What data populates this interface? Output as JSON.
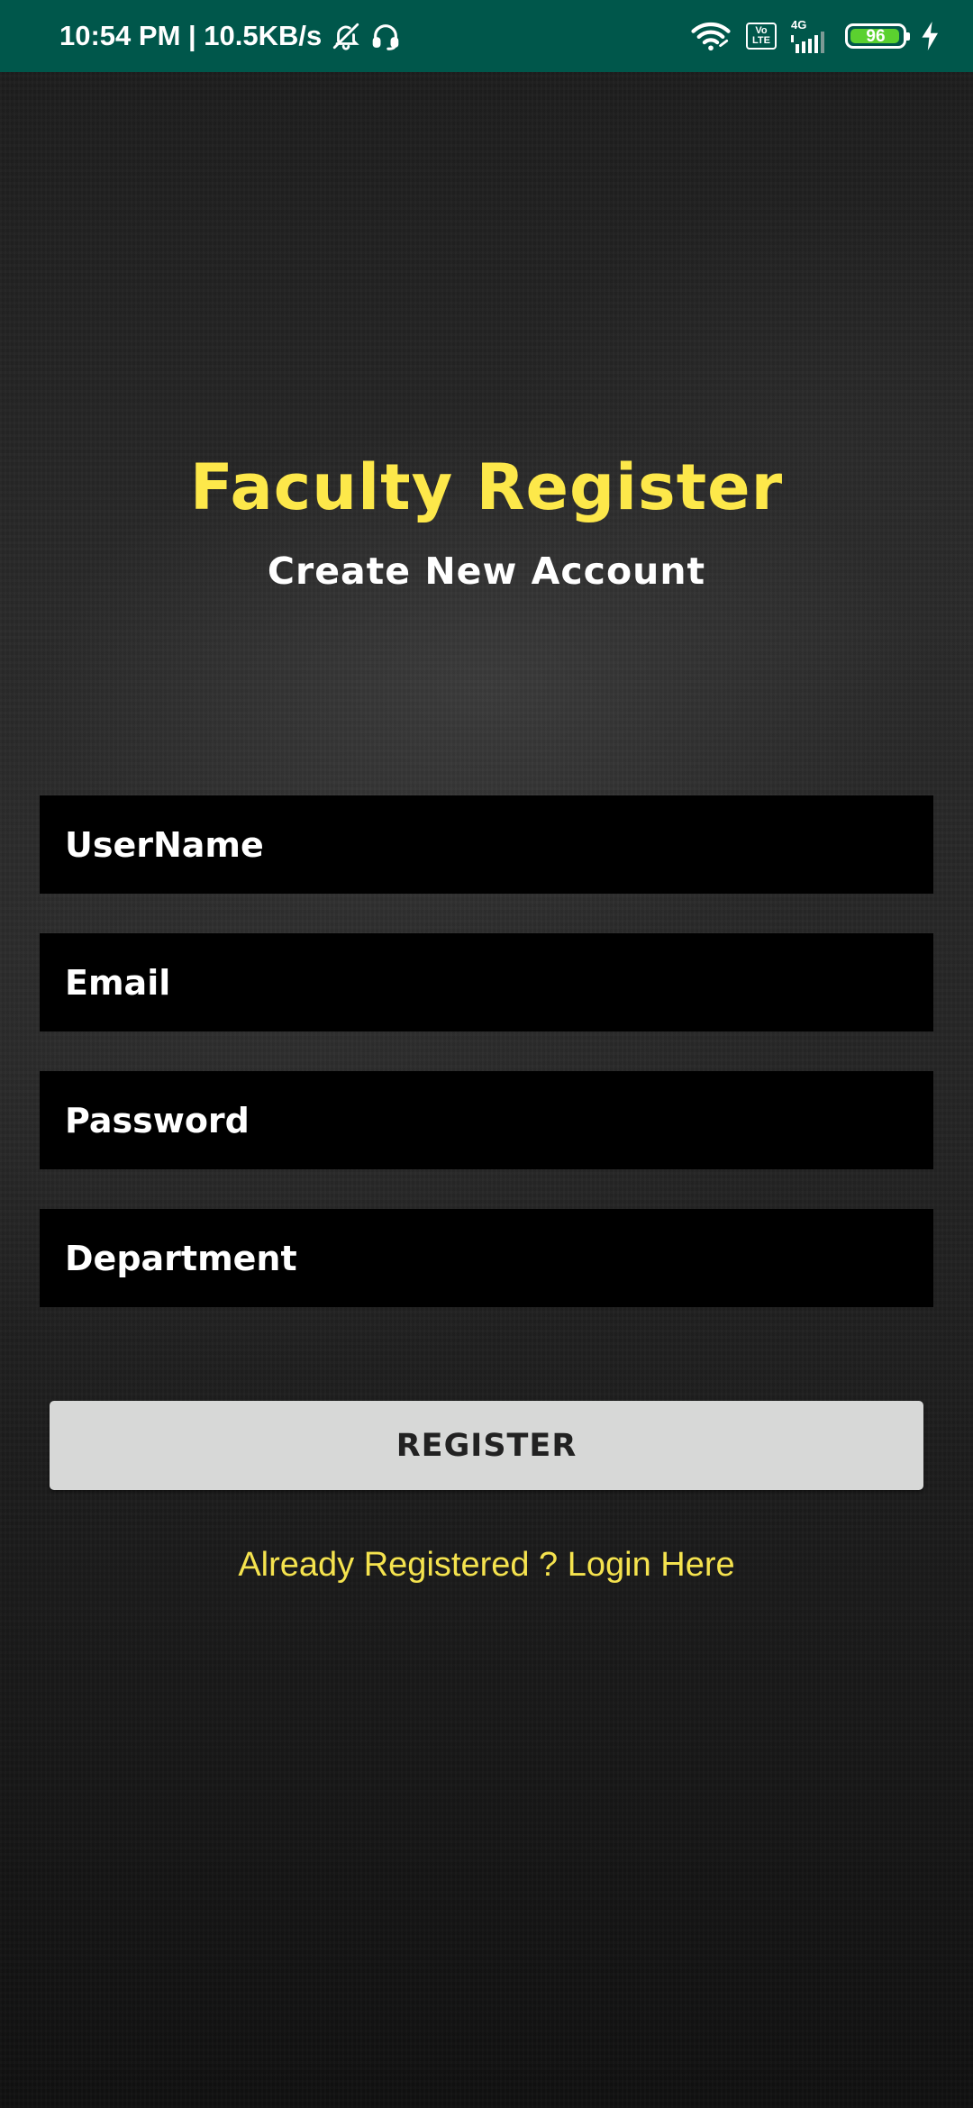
{
  "status_bar": {
    "time_speed": "10:54 PM | 10.5KB/s",
    "icons": [
      "mute-notifications-icon",
      "headset-icon",
      "wifi-icon",
      "volte-icon",
      "signal-icon",
      "battery-icon",
      "charging-icon"
    ],
    "volte_label": "Vo LTE",
    "network_label": "4G",
    "battery_level": "96",
    "background_color": "#00574b",
    "battery_color": "#5bd12f"
  },
  "header": {
    "title": "Faculty Register",
    "subtitle": "Create New Account",
    "title_color": "#fde84a"
  },
  "form": {
    "username_placeholder": "UserName",
    "email_placeholder": "Email",
    "password_placeholder": "Password",
    "department_placeholder": "Department",
    "username_value": "",
    "email_value": "",
    "password_value": "",
    "department_value": ""
  },
  "actions": {
    "register_label": "REGISTER",
    "login_link": "Already Registered ? Login Here",
    "link_color": "#f5e34e"
  }
}
